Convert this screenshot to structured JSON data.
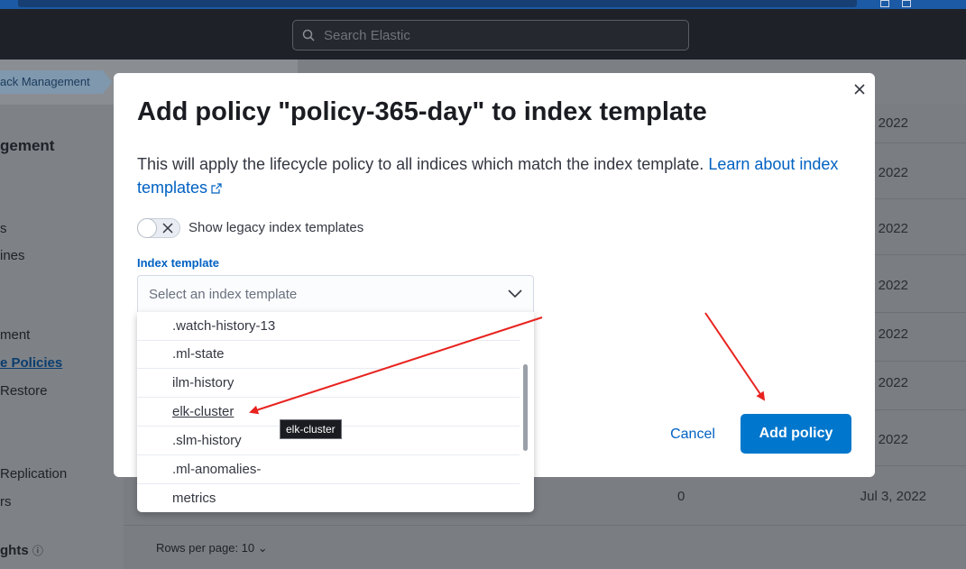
{
  "header": {
    "search_placeholder": "Search Elastic"
  },
  "background": {
    "breadcrumb": "ack Management",
    "sidebar": [
      "gement",
      "s",
      "ines",
      "ment",
      "e Policies",
      "Restore",
      "Replication",
      "rs",
      "ghts"
    ],
    "dates": [
      "2022",
      "2022",
      "2022",
      "2022",
      "2022",
      "2022",
      "2022"
    ],
    "last_row": {
      "count": "0",
      "date": "Jul 3, 2022"
    },
    "rows_per_page": "Rows per page: 10"
  },
  "modal": {
    "title": "Add policy \"policy-365-day\" to index template",
    "description": "This will apply the lifecycle policy to all indices which match the index template.",
    "learn_link": "Learn about index templates",
    "toggle_label": "Show legacy index templates",
    "field_label": "Index template",
    "select_placeholder": "Select an index template",
    "options": [
      ".watch-history-13",
      ".ml-state",
      "ilm-history",
      "elk-cluster",
      ".slm-history",
      ".ml-anomalies-",
      "metrics"
    ],
    "tooltip": "elk-cluster",
    "cancel_label": "Cancel",
    "add_label": "Add policy"
  },
  "colors": {
    "primary": "#0077cc",
    "link": "#0061c2",
    "annotation_arrow": "#e8231f"
  }
}
